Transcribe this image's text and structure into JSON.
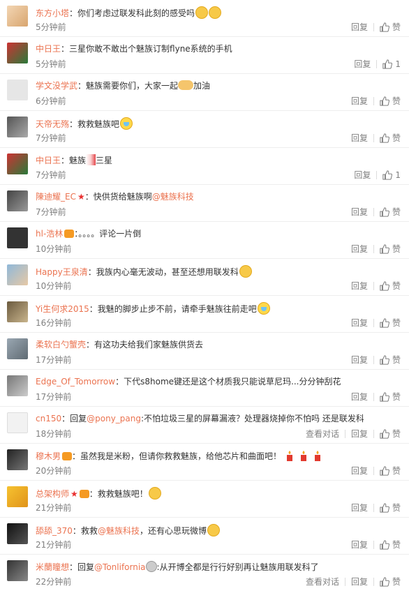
{
  "ui": {
    "reply": "回复",
    "like": "赞",
    "view_dialog": "查看对话"
  },
  "comments": [
    {
      "user": "东方小塔",
      "sep": "：",
      "text": "你们考虑过联发科此刻的感受吗",
      "time": "5分钟前",
      "likes": "赞",
      "dialog": false
    },
    {
      "user": "中日王",
      "sep": "：",
      "text": "三星你敢不敢出个魅族订制flyne系统的手机",
      "time": "5分钟前",
      "likes": "1",
      "dialog": false
    },
    {
      "user": "学文没学武",
      "sep": "：",
      "text": "魅族需要你们，大家一起",
      "text2": "加油",
      "time": "6分钟前",
      "likes": "赞",
      "dialog": false
    },
    {
      "user": "天帝无殇",
      "sep": "：",
      "text": "救救魅族吧",
      "time": "7分钟前",
      "likes": "赞",
      "dialog": false
    },
    {
      "user": "中日王",
      "sep": "：",
      "text": "魅族",
      "text2": "三星",
      "time": "7分钟前",
      "likes": "1",
      "dialog": false
    },
    {
      "user": "陳迪耀_EC",
      "sep": "：",
      "text": "快供货给魅族啊",
      "mention": "@魅族科技",
      "time": "7分钟前",
      "likes": "赞",
      "dialog": false
    },
    {
      "user": "hl-浩林",
      "sep": "：",
      "text": "。。。。评论一片倒",
      "time": "10分钟前",
      "likes": "赞",
      "dialog": false
    },
    {
      "user": "Happy王泉清",
      "sep": "：",
      "text": "我族内心毫无波动，甚至还想用联发科",
      "time": "10分钟前",
      "likes": "赞",
      "dialog": false
    },
    {
      "user": "Yi生何求2015",
      "sep": "：",
      "text": "我魅的脚步止步不前，请牵手魅族往前走吧",
      "time": "16分钟前",
      "likes": "赞",
      "dialog": false
    },
    {
      "user": "柔软白勺蟹壳",
      "sep": "：",
      "text": "有这功夫给我们家魅族供货去",
      "time": "17分钟前",
      "likes": "赞",
      "dialog": false
    },
    {
      "user": "Edge_Of_Tomorrow",
      "sep": "：",
      "text": "下代s8home键还是这个材质我只能说草尼玛...分分钟刮花",
      "time": "17分钟前",
      "likes": "赞",
      "dialog": false
    },
    {
      "user": "cn150",
      "sep": "：",
      "text": "回复",
      "mention": "@pony_pang",
      "text2": ":不怕垃圾三星的屏幕漏液？处理器烧掉你不怕吗 还是联发科吧",
      "time": "18分钟前",
      "likes": "赞",
      "dialog": true
    },
    {
      "user": "穆木男",
      "sep": "：",
      "text": "虽然我是米粉，但请你救救魅族，给他芯片和曲面吧！",
      "time": "20分钟前",
      "likes": "赞",
      "dialog": false
    },
    {
      "user": "总架构师",
      "sep": "：",
      "text": "救救魅族吧！",
      "time": "21分钟前",
      "likes": "赞",
      "dialog": false
    },
    {
      "user": "舔舔_370",
      "sep": "：",
      "text": "救救",
      "mention": "@魅族科技",
      "text2": "，还有心思玩微博",
      "time": "21分钟前",
      "likes": "赞",
      "dialog": false
    },
    {
      "user": "米蘭瞳想",
      "sep": "：",
      "text": "回复",
      "mention": "@Tonlifornia",
      "text2": ":从开博全都是行行好别再让魅族用联发科了",
      "time": "22分钟前",
      "likes": "赞",
      "dialog": true
    }
  ]
}
